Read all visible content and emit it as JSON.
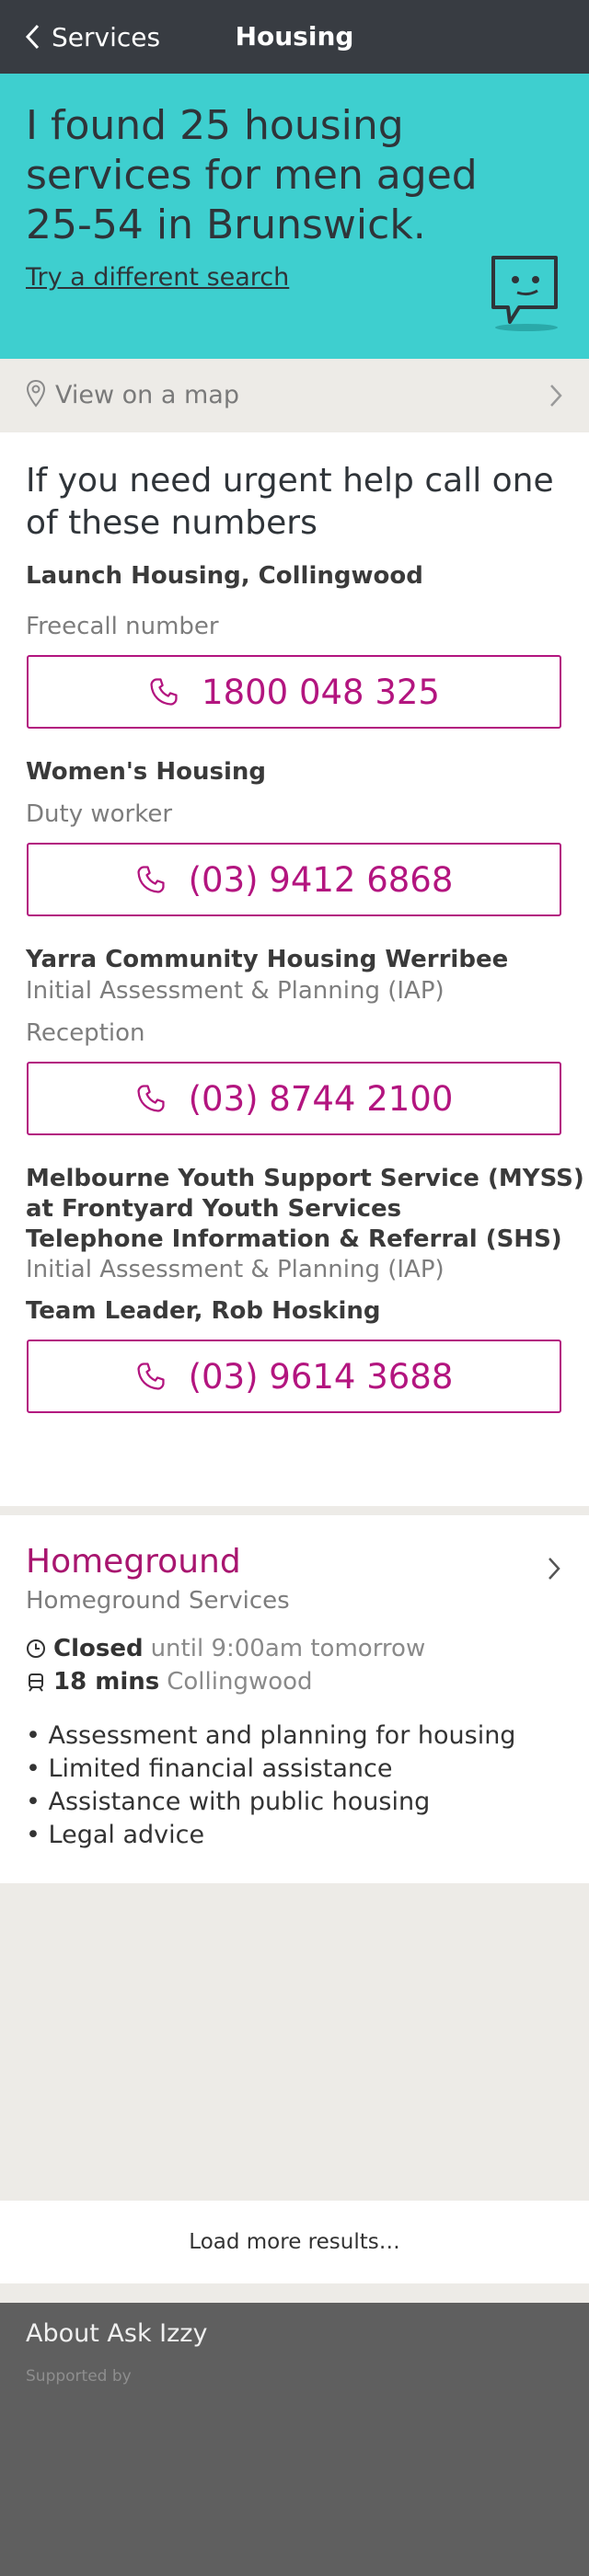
{
  "header": {
    "back_label": "Services",
    "title": "Housing"
  },
  "hero": {
    "title": "I found 25 housing services for men aged 25-54 in Brunswick.",
    "try_link": "Try a different search"
  },
  "map_row": {
    "label": "View on a map"
  },
  "urgent": {
    "title": "If you need urgent help call one of these numbers",
    "contacts": [
      {
        "lines": [
          "Launch Housing, Collingwood"
        ],
        "role": "Freecall number",
        "phone": "1800 048 325"
      },
      {
        "lines": [
          "Women's Housing"
        ],
        "role": "Duty worker",
        "phone": "(03) 9412 6868"
      },
      {
        "lines": [
          "Yarra Community Housing Werribee",
          "Initial Assessment & Planning (IAP)"
        ],
        "role": "Reception",
        "phone": "(03) 8744 2100"
      },
      {
        "lines": [
          "Melbourne Youth Support Service (MYSS)",
          "at Frontyard Youth Services",
          "Telephone Information & Referral (SHS)",
          "Initial Assessment & Planning (IAP)"
        ],
        "role": "Team Leader, Rob Hosking",
        "phone": "(03) 9614 3688"
      }
    ]
  },
  "result": {
    "name": "Homeground",
    "org": "Homeground Services",
    "status_strong": "Closed",
    "status_rest": "until 9:00am tomorrow",
    "travel_strong": "18 mins",
    "travel_rest": "Collingwood",
    "bullets": [
      "• Assessment and planning for housing",
      "• Limited financial assistance",
      "• Assistance with public housing",
      "• Legal advice"
    ]
  },
  "load_more": "Load more results…",
  "footer": {
    "about": "About Ask Izzy",
    "supported": "Supported by"
  },
  "colors": {
    "header_bg": "#383c42",
    "hero_bg": "#3ecfcf",
    "accent": "#b3157f",
    "footer_bg": "#5f5f5f"
  },
  "icons": [
    "chevron-left-icon",
    "chat-bubble-icon",
    "map-pin-icon",
    "chevron-right-icon",
    "phone-icon",
    "clock-icon",
    "tram-icon"
  ]
}
